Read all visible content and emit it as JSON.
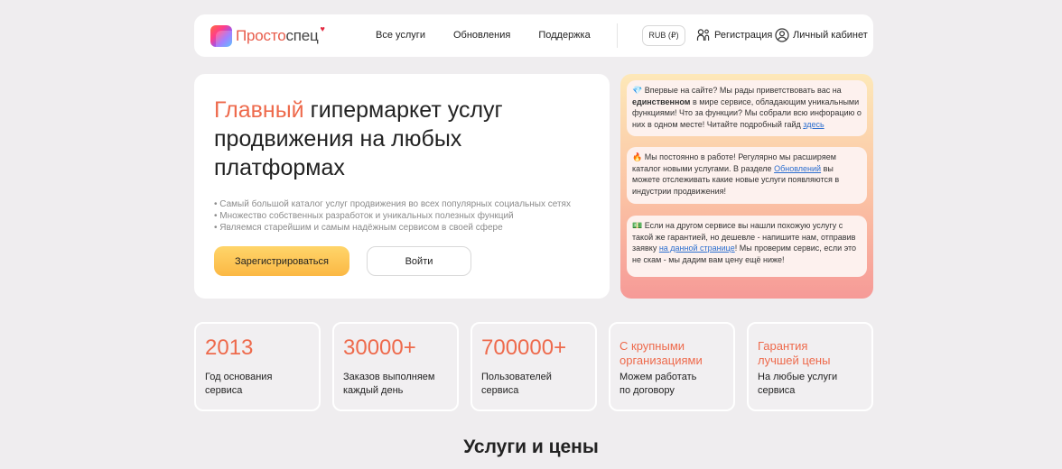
{
  "header": {
    "logo": {
      "text_prefix": "Просто",
      "text_suffix": "спец"
    },
    "nav": [
      "Все услуги",
      "Обновления",
      "Поддержка"
    ],
    "currency": "RUB (₽)",
    "register": "Регистрация",
    "cabinet": "Личный кабинет"
  },
  "hero": {
    "title_accent": "Главный",
    "title_rest": "гипермаркет услуг продвижения на любых платформах",
    "bullets": [
      "Самый большой каталог услуг продвижения во всех популярных социальных сетях",
      "Множество собственных разработок и уникальных полезных функций",
      "Являемся старейшим и самым надёжным сервисом в своей сфере"
    ],
    "btn_register": "Зарегистрироваться",
    "btn_login": "Войти"
  },
  "info": {
    "card1": {
      "emoji": "💎",
      "t1": " Впервые на сайте? Мы рады приветствовать вас на ",
      "bold": "единственном",
      "t2": " в мире сервисе, обладающим уникальными функциями! Что за функции? Мы собрали всю инфорацию о них в одном месте! Читайте подробный гайд ",
      "link": "здесь"
    },
    "card2": {
      "emoji": "🔥",
      "t1": " Мы постоянно в работе! Регулярно мы расширяем каталог новыми услугами. В разделе ",
      "link": "Обновлений",
      "t2": " вы можете отслеживать какие новые услуги появляются в индустрии продвижения!"
    },
    "card3": {
      "emoji": "💵",
      "t1": " Если на другом сервисе вы нашли похожую услугу с такой же гарантией, но дешевле - напишите нам, отправив заявку ",
      "link": "на данной странице",
      "t2": "! Мы проверим сервис, если это не скам - мы дадим вам цену ещё ниже!"
    }
  },
  "stats": [
    {
      "value": "2013",
      "line1": "Год основания",
      "line2": "сервиса"
    },
    {
      "value": "30000+",
      "line1": "Заказов выполняем",
      "line2": "каждый день"
    },
    {
      "value": "700000+",
      "line1": "Пользователей",
      "line2": "сервиса"
    },
    {
      "head1": "С крупными",
      "head2": "организациями",
      "line1": "Можем работать",
      "line2": "по договору"
    },
    {
      "head1": "Гарантия",
      "head2": "лучшей цены",
      "line1": "На любые услуги",
      "line2": "сервиса"
    }
  ],
  "section_title": "Услуги и цены",
  "colors": {
    "accent": "#ee6a4c",
    "button_yellow": "#fbb844",
    "link": "#2d6fcf",
    "background": "#efedef"
  }
}
